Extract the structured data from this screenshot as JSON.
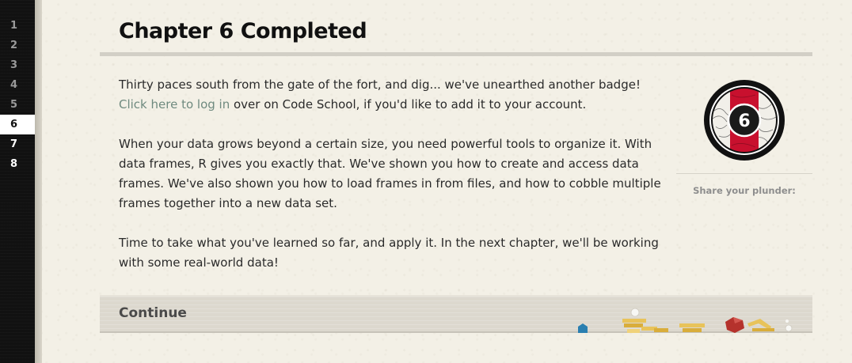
{
  "chapter_nav": {
    "items": [
      {
        "label": "1",
        "state": "done"
      },
      {
        "label": "2",
        "state": "done"
      },
      {
        "label": "3",
        "state": "done"
      },
      {
        "label": "4",
        "state": "done"
      },
      {
        "label": "5",
        "state": "done"
      },
      {
        "label": "6",
        "state": "current"
      },
      {
        "label": "7",
        "state": "upcoming"
      },
      {
        "label": "8",
        "state": "upcoming"
      }
    ]
  },
  "page": {
    "title": "Chapter 6 Completed"
  },
  "body": {
    "p1_before_link": "Thirty paces south from the gate of the fort, and dig... we've unearthed another badge! ",
    "p1_link": "Click here to log in",
    "p1_after_link": " over on Code School, if you'd like to add it to your account.",
    "p2": "When your data grows beyond a certain size, you need powerful tools to organize it. With data frames, R gives you exactly that. We've shown you how to create and access data frames. We've also shown you how to load frames in from files, and how to cobble multiple frames together into a new data set.",
    "p3": "Time to take what you've learned so far, and apply it. In the next chapter, we'll be working with some real-world data!"
  },
  "badge": {
    "number": "6",
    "colors": {
      "ring": "#111111",
      "stripe": "#c8102e",
      "inner": "#ffffff"
    }
  },
  "share": {
    "label": "Share your plunder:"
  },
  "continue": {
    "label": "Continue"
  },
  "colors": {
    "background": "#f3f0e6",
    "nav": "#111111",
    "link": "#6f8a7f",
    "gold": "#e8c35a",
    "ruby": "#b5322c",
    "sapphire": "#2a7fb0"
  }
}
